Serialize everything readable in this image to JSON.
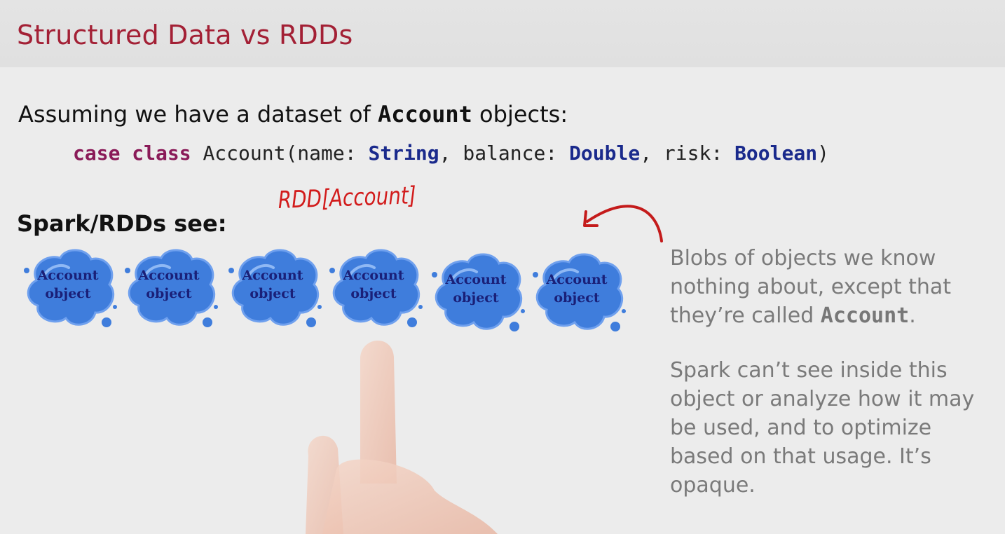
{
  "slide": {
    "title": "Structured Data vs RDDs",
    "intro_before": "Assuming we have a dataset of ",
    "intro_keyword": "Account",
    "intro_after": " objects:",
    "code": {
      "kw1": "case",
      "kw2": "class",
      "part_class": " Account(name: ",
      "type1": "String",
      "part_balance": ", balance: ",
      "type2": "Double",
      "part_risk": ", risk: ",
      "type3": "Boolean",
      "close": ")"
    },
    "sees_label": "Spark/RDDs see:",
    "handwritten_annotation": "RDD[Account]",
    "blobs": [
      {
        "line1": "Account",
        "line2": "object"
      },
      {
        "line1": "Account",
        "line2": "object"
      },
      {
        "line1": "Account",
        "line2": "object"
      },
      {
        "line1": "Account",
        "line2": "object"
      },
      {
        "line1": "Account",
        "line2": "object"
      },
      {
        "line1": "Account",
        "line2": "object"
      }
    ],
    "side_text_1_before": "Blobs of objects we know nothing about, except that they’re called ",
    "side_text_1_keyword": "Account",
    "side_text_1_after": ".",
    "side_text_2": "Spark can’t see inside this object or analyze how it may be used, and to optimize based on that usage. It’s opaque."
  },
  "colors": {
    "title": "#a32035",
    "keyword": "#8a1a58",
    "type": "#1a2a8c",
    "blob_fill": "#3f7ddc",
    "blob_text": "#1a2078",
    "annotation": "#d21b1b",
    "side_text": "#7a7a7a"
  }
}
